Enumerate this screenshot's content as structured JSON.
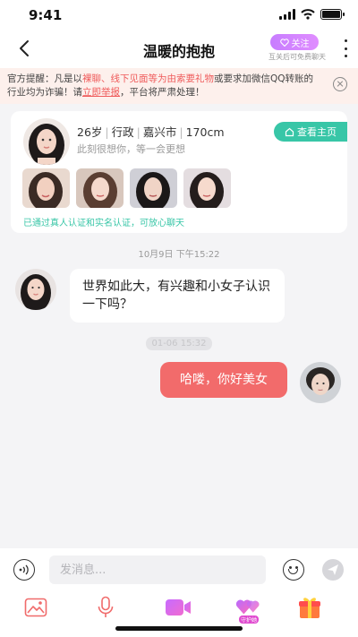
{
  "status_bar": {
    "time": "9:41"
  },
  "nav": {
    "title": "温暖的抱抱",
    "follow_label": "关注",
    "follow_tip": "互关后可免费聊天"
  },
  "notice": {
    "part1": "官方提醒：凡是以",
    "highlight": "裸聊、线下见面等为由索要礼物",
    "part2": "或要求加微信QQ转账的行业均为诈骗！请",
    "report_link": "立即举报",
    "part3": "，平台将严肃处理！"
  },
  "profile_card": {
    "age": "26岁",
    "job": "行政",
    "city": "嘉兴市",
    "height": "170cm",
    "quote": "此刻很想你，等一会更想",
    "homepage_label": "查看主页",
    "verified_text": "已通过真人认证和实名认证，可放心聊天"
  },
  "chat": {
    "timestamp": "10月9日 下午15:22",
    "timestamp2": "01-06 15:32",
    "received_message": "世界如此大，有兴趣和小女子认识一下吗？",
    "sent_message": "哈喽，你好美女"
  },
  "input": {
    "placeholder": "发消息...",
    "guard_badge": "守护她"
  },
  "colors": {
    "accent_red": "#f26b6b",
    "teal": "#38c6a7",
    "purple": "#c77dff"
  }
}
